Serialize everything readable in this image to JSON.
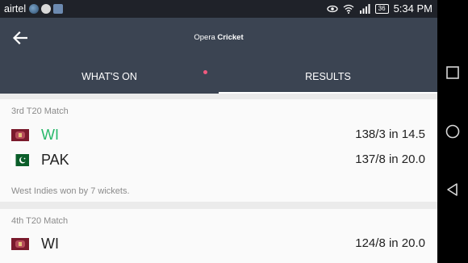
{
  "status_bar": {
    "carrier": "airtel",
    "battery": "36",
    "time": "5:34 PM"
  },
  "app_bar": {
    "title_prefix": "Opera",
    "title_main": "Cricket"
  },
  "tabs": [
    {
      "label": "WHAT'S ON"
    },
    {
      "label": "RESULTS"
    }
  ],
  "matches": [
    {
      "label": "3rd T20 Match",
      "teams": [
        {
          "name": "WI",
          "score": "138/3 in 14.5",
          "flag": "west-indies-flag",
          "winner": true
        },
        {
          "name": "PAK",
          "score": "137/8 in 20.0",
          "flag": "pakistan-flag",
          "winner": false
        }
      ],
      "result": "West Indies won by 7 wickets."
    },
    {
      "label": "4th T20 Match",
      "teams": [
        {
          "name": "WI",
          "score": "124/8 in 20.0",
          "flag": "west-indies-flag",
          "winner": false
        }
      ]
    }
  ],
  "colors": {
    "appbar": "#3b4452",
    "winner_green": "#27b86a",
    "notification_dot": "#f05a7e"
  }
}
